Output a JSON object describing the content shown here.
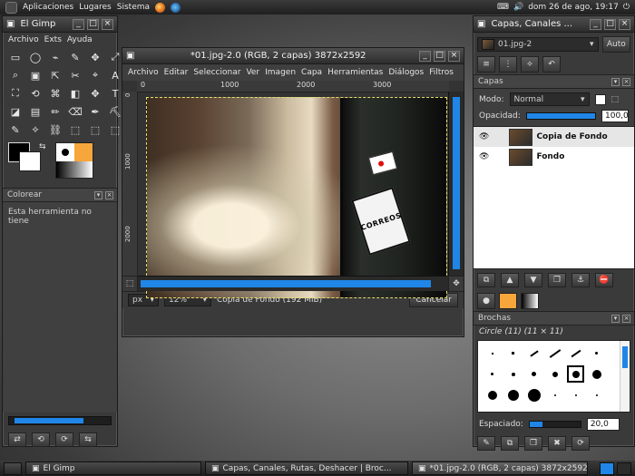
{
  "desktop": {
    "topbar": {
      "menus": [
        "Aplicaciones",
        "Lugares",
        "Sistema"
      ],
      "clock": "dom 26 de ago, 19:17"
    }
  },
  "toolbox": {
    "title": "El Gimp",
    "menu": [
      "Archivo",
      "Exts",
      "Ayuda"
    ],
    "section_title": "Colorear",
    "message": "Esta herramienta no tiene",
    "tools": [
      "▭",
      "◯",
      "⌁",
      "✎",
      "✥",
      "⤢",
      "⌕",
      "▣",
      "⇱",
      "✂",
      "⌖",
      "A",
      "⛶",
      "⟲",
      "⌘",
      "◧",
      "✥",
      "T",
      "◪",
      "▤",
      "✏",
      "⌫",
      "✒",
      "⛏",
      "✎",
      "⟡",
      "⛓",
      "⬚",
      "⬚",
      "⬚"
    ],
    "footer_buttons": [
      "⇄",
      "⟲",
      "⟳",
      "⇆"
    ]
  },
  "image_window": {
    "title": "*01.jpg-2.0 (RGB, 2 capas) 3872x2592",
    "menu": [
      "Archivo",
      "Editar",
      "Seleccionar",
      "Ver",
      "Imagen",
      "Capa",
      "Herramientas",
      "Diálogos",
      "Filtros"
    ],
    "ruler_labels": [
      "0",
      "1000",
      "2000",
      "3000"
    ],
    "vertical_ruler_labels": [
      "0",
      "1000",
      "2000"
    ],
    "unit": "px",
    "zoom": "12%",
    "status": "Copia de Fondo (192 MiB)",
    "cancel_label": "Cancelar",
    "photo_text": "CORREOS"
  },
  "layers_dialog": {
    "title": "Capas, Canales ...",
    "image_select": "01.jpg-2",
    "auto_label": "Auto",
    "panel_title": "Capas",
    "mode_label": "Modo:",
    "mode_value": "Normal",
    "opacity_label": "Opacidad:",
    "opacity_value": "100,0",
    "opacity": 1.0,
    "layers": [
      {
        "name": "Copia de Fondo",
        "visible": true,
        "selected": true
      },
      {
        "name": "Fondo",
        "visible": true,
        "selected": false
      }
    ],
    "brushes_title": "Brochas",
    "brush_name": "Circle (11) (11 × 11)",
    "spacing_label": "Espaciado:",
    "spacing_value": "20,0"
  },
  "taskbar": {
    "items": [
      {
        "label": "El Gimp",
        "active": false
      },
      {
        "label": "Capas, Canales, Rutas, Deshacer | Broc...",
        "active": false
      },
      {
        "label": "*01.jpg-2.0 (RGB, 2 capas) 3872x2592",
        "active": true
      }
    ]
  },
  "colors": {
    "accent_blue": "#1f86e8",
    "panel": "#3a3a3a",
    "white": "#ffffff"
  }
}
